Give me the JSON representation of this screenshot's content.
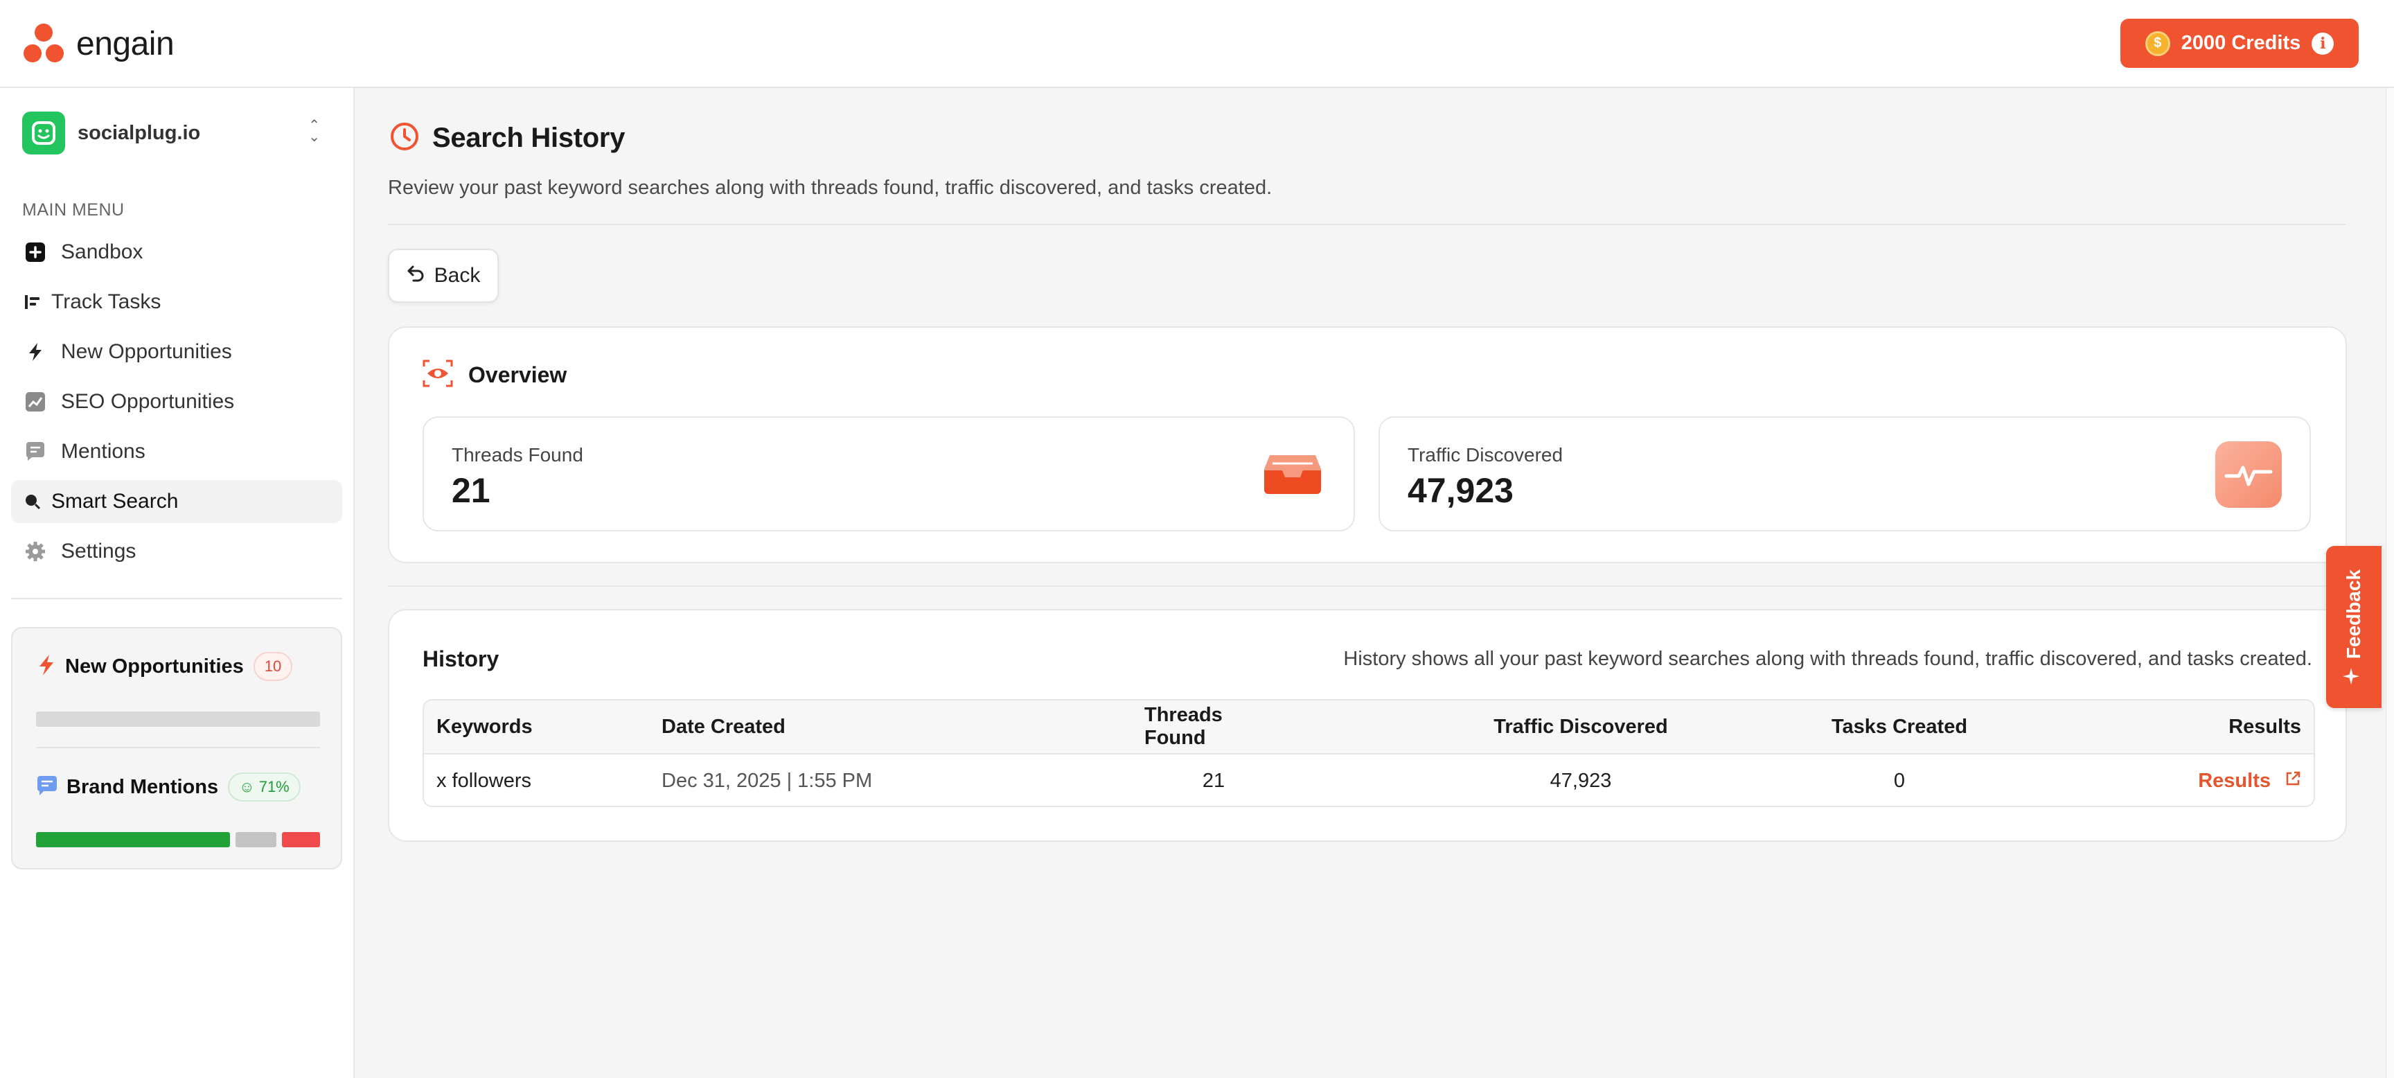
{
  "header": {
    "brand": "engain",
    "credits_label": "2000 Credits",
    "accent_color": "#f0532f"
  },
  "sidebar": {
    "workspace_name": "socialplug.io",
    "menu_label": "MAIN MENU",
    "items": [
      {
        "label": "Sandbox",
        "icon": "plus-square-icon"
      },
      {
        "label": "Track Tasks",
        "icon": "tasks-icon"
      },
      {
        "label": "New Opportunities",
        "icon": "bolt-icon"
      },
      {
        "label": "SEO Opportunities",
        "icon": "chart-icon"
      },
      {
        "label": "Mentions",
        "icon": "message-icon"
      },
      {
        "label": "Smart Search",
        "icon": "search-icon",
        "active": true
      },
      {
        "label": "Settings",
        "icon": "gear-icon"
      }
    ],
    "card": {
      "new_opps_title": "New Opportunities",
      "new_opps_count": "10",
      "brand_mentions_title": "Brand Mentions",
      "brand_mentions_pct": "71%",
      "sentiment_bar": {
        "positive": 0.71,
        "neutral": 0.15,
        "negative": 0.14
      }
    }
  },
  "page": {
    "title": "Search History",
    "subtitle": "Review your past keyword searches along with threads found, traffic discovered, and tasks created.",
    "back_label": "Back"
  },
  "overview": {
    "title": "Overview",
    "threads_label": "Threads Found",
    "threads_value": "21",
    "traffic_label": "Traffic Discovered",
    "traffic_value": "47,923"
  },
  "history": {
    "title": "History",
    "description": "History shows all your past keyword searches along with threads found, traffic discovered, and tasks created.",
    "columns": [
      "Keywords",
      "Date Created",
      "Threads Found",
      "Traffic Discovered",
      "Tasks Created",
      "Results"
    ],
    "rows": [
      {
        "keywords": "x followers",
        "date": "Dec 31, 2025 | 1:55 PM",
        "threads": "21",
        "traffic": "47,923",
        "tasks": "0",
        "results": "Results"
      }
    ]
  },
  "feedback_label": "Feedback"
}
